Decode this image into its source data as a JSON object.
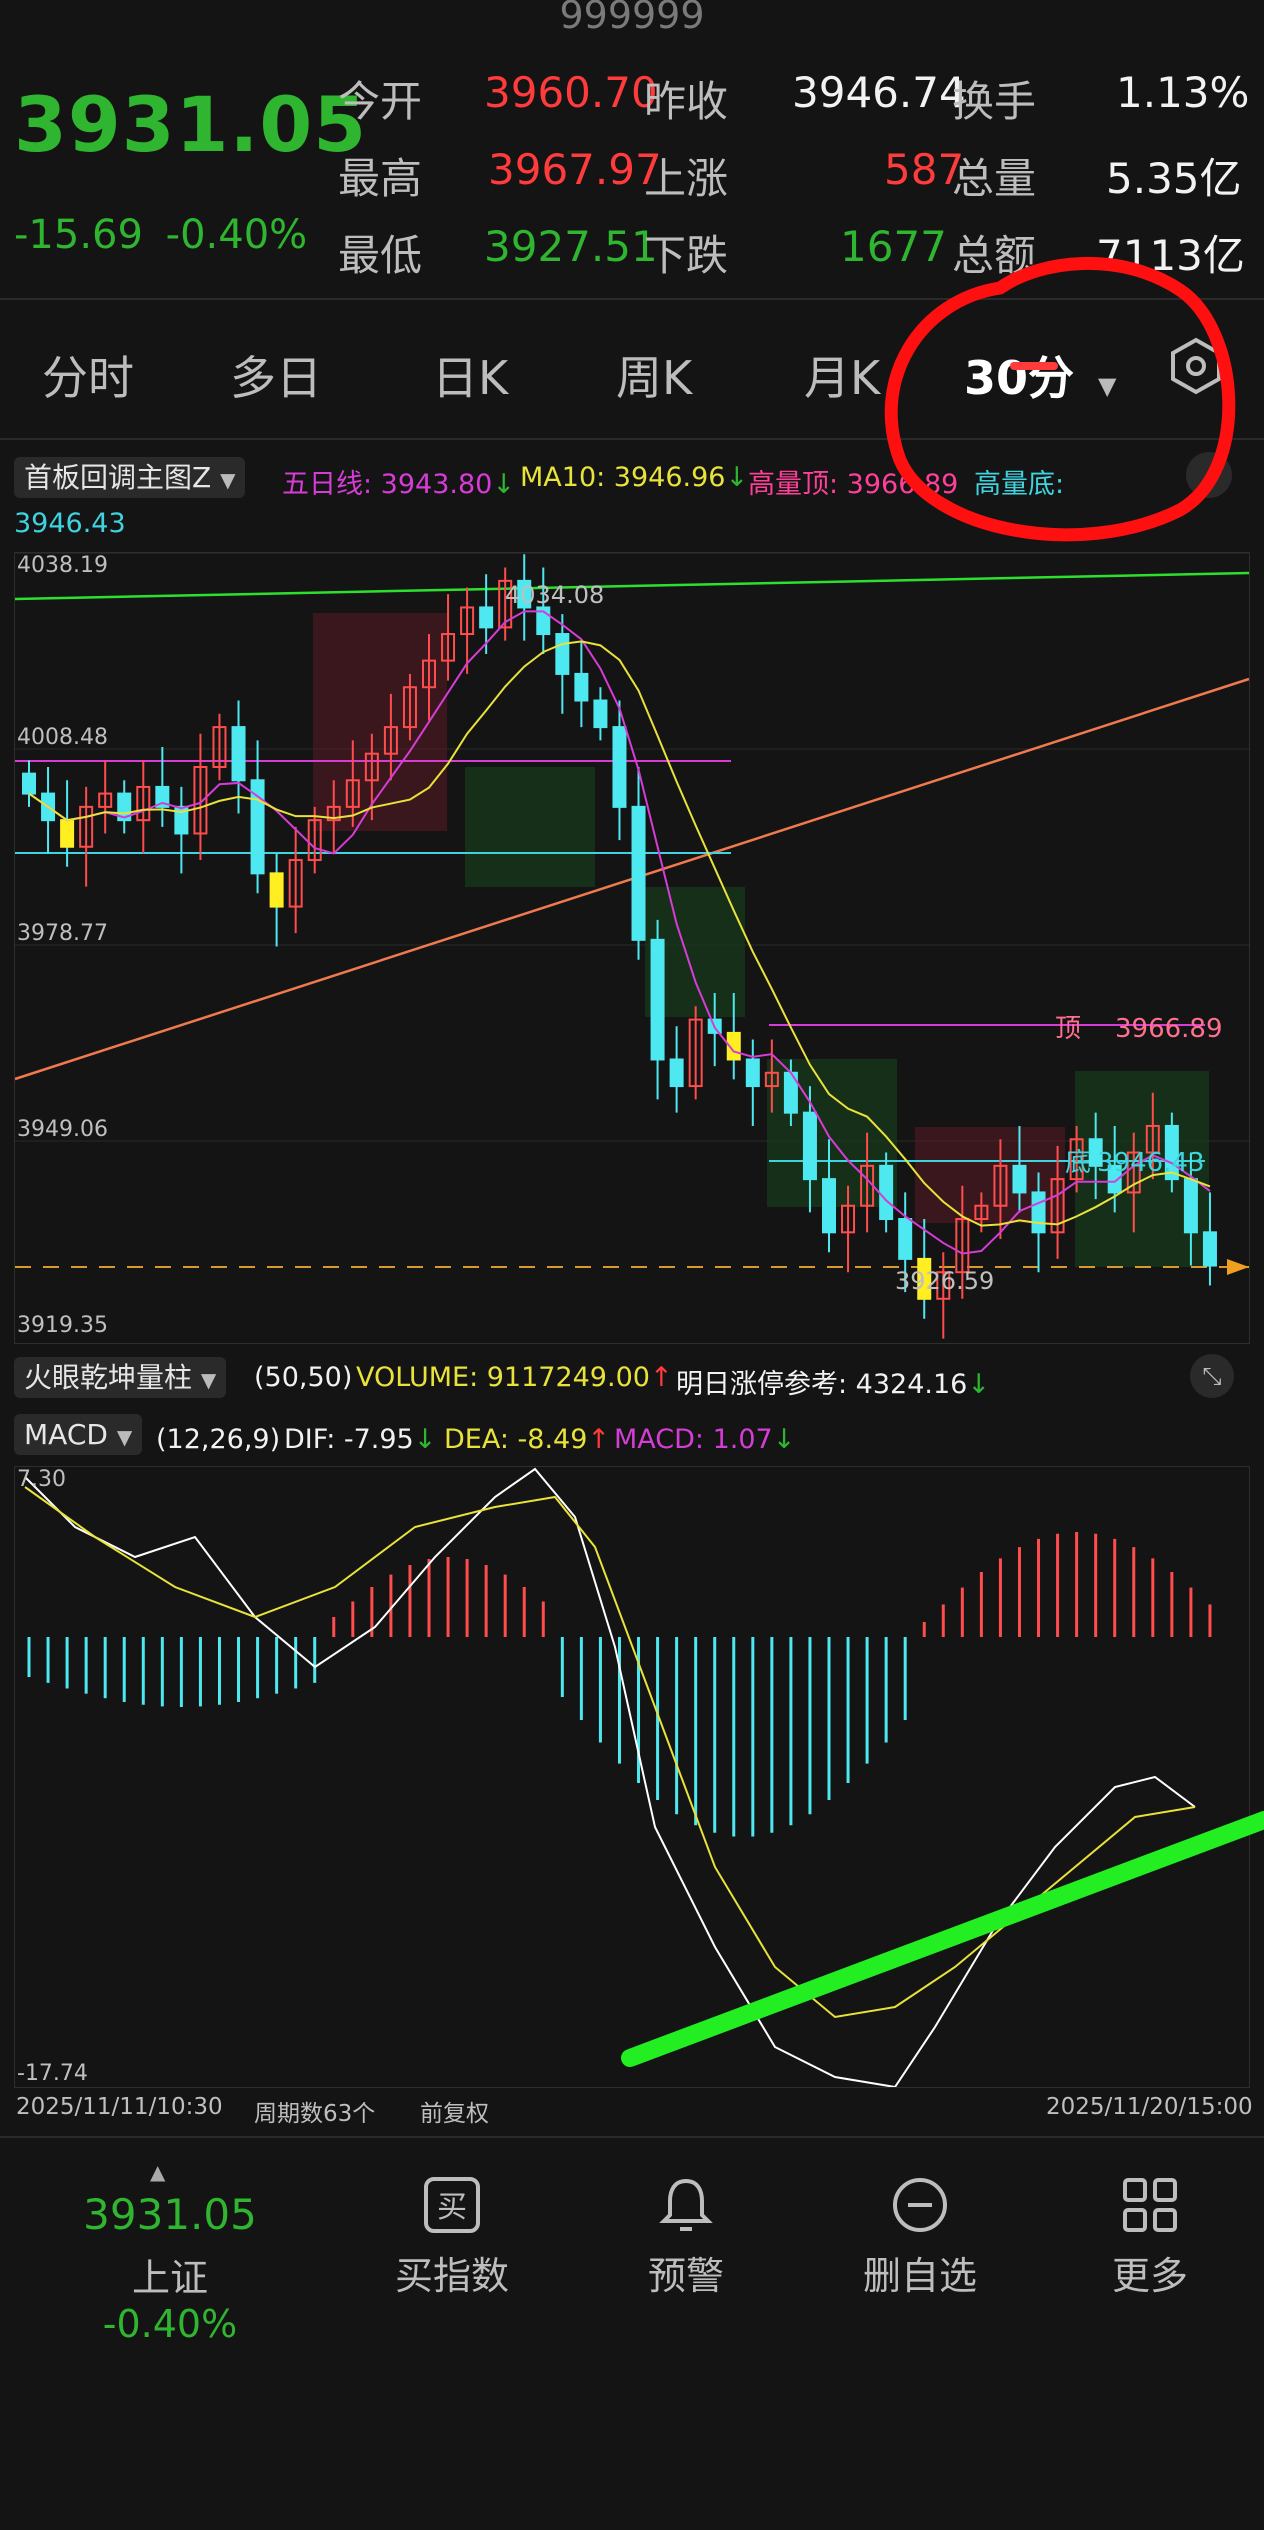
{
  "header": {
    "code": "999999"
  },
  "quote": {
    "price": "3931.05",
    "change": "-15.69",
    "change_pct": "-0.40%",
    "stats": [
      {
        "label": "今开",
        "value": "3960.70",
        "label2": "昨收",
        "value2": "3946.74",
        "label3": "换手",
        "value3": "1.13%"
      },
      {
        "label": "最高",
        "value": "3967.97",
        "label2": "上涨",
        "value2": "587",
        "label3": "总量",
        "value3": "5.35亿"
      },
      {
        "label": "最低",
        "value": "3927.51",
        "label2": "下跌",
        "value2": "1677",
        "label3": "总额",
        "value3": "7113亿"
      }
    ]
  },
  "tabs": [
    "分时",
    "多日",
    "日K",
    "周K",
    "月K",
    "30分"
  ],
  "active_tab": "30分",
  "indicator_bar": {
    "selector": "首板回调主图Z",
    "ma5": "五日线: 3943.80",
    "ma10": "MA10: 3946.96",
    "high_top": "高量顶: 3966.89",
    "high_bottom": "高量底:",
    "bottom_value": "3946.43"
  },
  "main_chart": {
    "y_ticks": [
      "4038.19",
      "4008.48",
      "3978.77",
      "3949.06",
      "3919.35"
    ],
    "labels": {
      "peak": "4034.08",
      "low": "3926.59",
      "top_tag": "顶",
      "top_value": "3966.89",
      "bottom_tag": "底",
      "bottom_value": "3946.43"
    }
  },
  "volume_bar": {
    "selector": "火眼乾坤量柱",
    "params": "(50,50)",
    "volume": "VOLUME: 9117249.00",
    "ref": "明日涨停参考: 4324.16"
  },
  "macd_bar": {
    "selector": "MACD",
    "params": "(12,26,9)",
    "dif": "DIF: -7.95",
    "dea": "DEA: -8.49",
    "macd": "MACD: 1.07",
    "y_top": "7.30",
    "y_bottom": "-17.74"
  },
  "footer_info": {
    "start": "2025/11/11/10:30",
    "periods": "周期数63个",
    "adjust": "前复权",
    "end": "2025/11/20/15:00"
  },
  "bottom_nav": {
    "quote_price": "3931.05",
    "quote_name": "上证",
    "quote_pct": "-0.40%",
    "items": [
      "买指数",
      "预警",
      "删自选",
      "更多"
    ]
  },
  "colors": {
    "up": "#ff3b3b",
    "down": "#2fb52f",
    "bg": "#141414",
    "annotation": "#ff0000"
  }
}
